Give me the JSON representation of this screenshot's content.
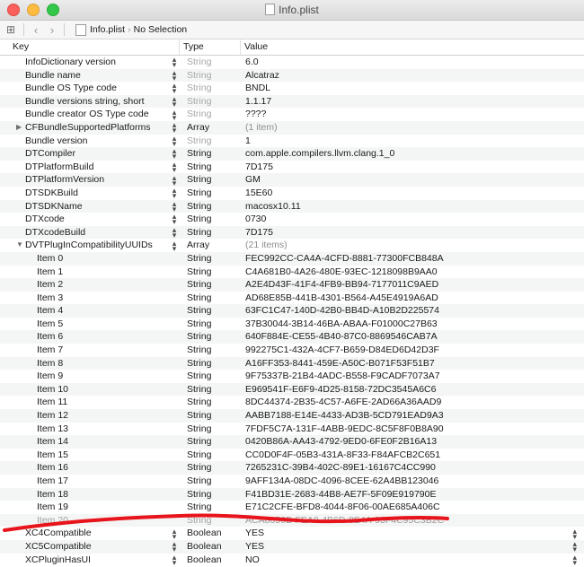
{
  "window": {
    "title": "Info.plist"
  },
  "jumpbar": {
    "file": "Info.plist",
    "selection": "No Selection"
  },
  "columns": {
    "key": "Key",
    "type": "Type",
    "value": "Value"
  },
  "rows": [
    {
      "key": "InfoDictionary version",
      "type": "String",
      "value": "6.0",
      "level": 0,
      "dimType": true
    },
    {
      "key": "Bundle name",
      "type": "String",
      "value": "Alcatraz",
      "level": 0,
      "dimType": true
    },
    {
      "key": "Bundle OS Type code",
      "type": "String",
      "value": "BNDL",
      "level": 0,
      "dimType": true
    },
    {
      "key": "Bundle versions string, short",
      "type": "String",
      "value": "1.1.17",
      "level": 0,
      "dimType": true
    },
    {
      "key": "Bundle creator OS Type code",
      "type": "String",
      "value": "????",
      "level": 0,
      "dimType": true
    },
    {
      "key": "CFBundleSupportedPlatforms",
      "type": "Array",
      "value": "(1 item)",
      "level": 0,
      "disclosure": "collapsed",
      "dimValue": true
    },
    {
      "key": "Bundle version",
      "type": "String",
      "value": "1",
      "level": 0,
      "dimType": true
    },
    {
      "key": "DTCompiler",
      "type": "String",
      "value": "com.apple.compilers.llvm.clang.1_0",
      "level": 0
    },
    {
      "key": "DTPlatformBuild",
      "type": "String",
      "value": "7D175",
      "level": 0
    },
    {
      "key": "DTPlatformVersion",
      "type": "String",
      "value": "GM",
      "level": 0
    },
    {
      "key": "DTSDKBuild",
      "type": "String",
      "value": "15E60",
      "level": 0
    },
    {
      "key": "DTSDKName",
      "type": "String",
      "value": "macosx10.11",
      "level": 0
    },
    {
      "key": "DTXcode",
      "type": "String",
      "value": "0730",
      "level": 0
    },
    {
      "key": "DTXcodeBuild",
      "type": "String",
      "value": "7D175",
      "level": 0
    },
    {
      "key": "DVTPlugInCompatibilityUUIDs",
      "type": "Array",
      "value": "(21 items)",
      "level": 0,
      "disclosure": "expanded",
      "dimValue": true
    },
    {
      "key": "Item 0",
      "type": "String",
      "value": "FEC992CC-CA4A-4CFD-8881-77300FCB848A",
      "level": 1
    },
    {
      "key": "Item 1",
      "type": "String",
      "value": "C4A681B0-4A26-480E-93EC-1218098B9AA0",
      "level": 1
    },
    {
      "key": "Item 2",
      "type": "String",
      "value": "A2E4D43F-41F4-4FB9-BB94-7177011C9AED",
      "level": 1
    },
    {
      "key": "Item 3",
      "type": "String",
      "value": "AD68E85B-441B-4301-B564-A45E4919A6AD",
      "level": 1
    },
    {
      "key": "Item 4",
      "type": "String",
      "value": "63FC1C47-140D-42B0-BB4D-A10B2D225574",
      "level": 1
    },
    {
      "key": "Item 5",
      "type": "String",
      "value": "37B30044-3B14-46BA-ABAA-F01000C27B63",
      "level": 1
    },
    {
      "key": "Item 6",
      "type": "String",
      "value": "640F884E-CE55-4B40-87C0-8869546CAB7A",
      "level": 1
    },
    {
      "key": "Item 7",
      "type": "String",
      "value": "992275C1-432A-4CF7-B659-D84ED6D42D3F",
      "level": 1
    },
    {
      "key": "Item 8",
      "type": "String",
      "value": "A16FF353-8441-459E-A50C-B071F53F51B7",
      "level": 1
    },
    {
      "key": "Item 9",
      "type": "String",
      "value": "9F75337B-21B4-4ADC-B558-F9CADF7073A7",
      "level": 1
    },
    {
      "key": "Item 10",
      "type": "String",
      "value": "E969541F-E6F9-4D25-8158-72DC3545A6C6",
      "level": 1
    },
    {
      "key": "Item 11",
      "type": "String",
      "value": "8DC44374-2B35-4C57-A6FE-2AD66A36AAD9",
      "level": 1
    },
    {
      "key": "Item 12",
      "type": "String",
      "value": "AABB7188-E14E-4433-AD3B-5CD791EAD9A3",
      "level": 1
    },
    {
      "key": "Item 13",
      "type": "String",
      "value": "7FDF5C7A-131F-4ABB-9EDC-8C5F8F0B8A90",
      "level": 1
    },
    {
      "key": "Item 14",
      "type": "String",
      "value": "0420B86A-AA43-4792-9ED0-6FE0F2B16A13",
      "level": 1
    },
    {
      "key": "Item 15",
      "type": "String",
      "value": "CC0D0F4F-05B3-431A-8F33-F84AFCB2C651",
      "level": 1
    },
    {
      "key": "Item 16",
      "type": "String",
      "value": "7265231C-39B4-402C-89E1-16167C4CC990",
      "level": 1
    },
    {
      "key": "Item 17",
      "type": "String",
      "value": "9AFF134A-08DC-4096-8CEE-62A4BB123046",
      "level": 1
    },
    {
      "key": "Item 18",
      "type": "String",
      "value": "F41BD31E-2683-44B8-AE7F-5F09E919790E",
      "level": 1
    },
    {
      "key": "Item 19",
      "type": "String",
      "value": "E71C2CFE-BFD8-4044-8F06-00AE685A406C",
      "level": 1
    },
    {
      "key": "Item 20",
      "type": "String",
      "value": "ACA8656B-FEA8-4B6D-8E4A-93F4C95C3B2C",
      "level": 1,
      "fade": true
    },
    {
      "key": "XC4Compatible",
      "type": "Boolean",
      "value": "YES",
      "level": 0,
      "boolStepper": true
    },
    {
      "key": "XC5Compatible",
      "type": "Boolean",
      "value": "YES",
      "level": 0,
      "boolStepper": true
    },
    {
      "key": "XCPluginHasUI",
      "type": "Boolean",
      "value": "NO",
      "level": 0,
      "boolStepper": true
    }
  ],
  "annotation": {
    "color": "#e8141b"
  }
}
